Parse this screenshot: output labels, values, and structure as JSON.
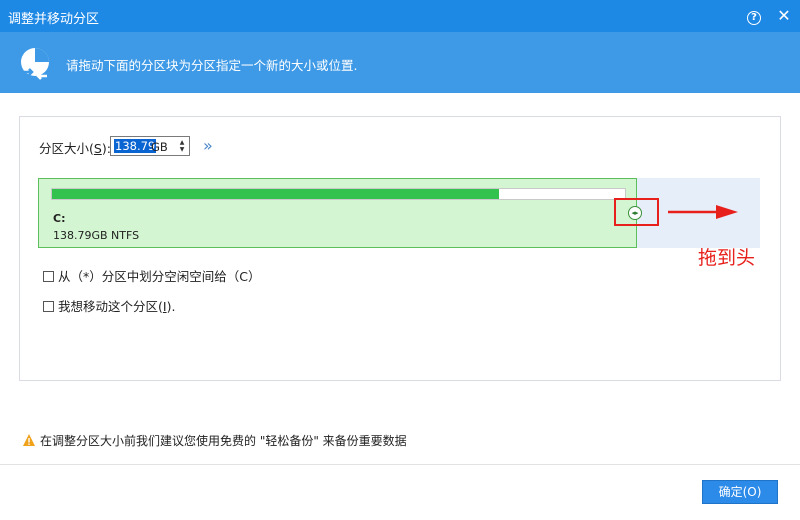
{
  "window": {
    "title": "调整并移动分区",
    "help_label": "?",
    "close_label": "✕"
  },
  "banner": {
    "text": "请拖动下面的分区块为分区指定一个新的大小或位置."
  },
  "size": {
    "label": "分区大小(",
    "label_key": "S",
    "label_end": "):",
    "value": "138.79",
    "unit": "GB",
    "expand_label": "»"
  },
  "partition": {
    "drive_letter": "C:",
    "info": "138.79GB NTFS",
    "used_fraction": 0.78
  },
  "annotation": {
    "text": "拖到头"
  },
  "options": {
    "allocate_space": "从（*）分区中划分空闲空间给（C）",
    "move_prefix": "我想移动这个分区(",
    "move_key": "I",
    "move_suffix": ")."
  },
  "warning": {
    "text": "在调整分区大小前我们建议您使用免费的 \"轻松备份\" 来备份重要数据"
  },
  "footer": {
    "ok_label": "确定(O)"
  },
  "colors": {
    "titlebar": "#1e88e5",
    "banner": "#3e9ae6",
    "partition_fill": "#d4f5d2",
    "usage_fill": "#34c24f",
    "annotation": "#e8201b",
    "ok_button": "#2c8ae8"
  }
}
